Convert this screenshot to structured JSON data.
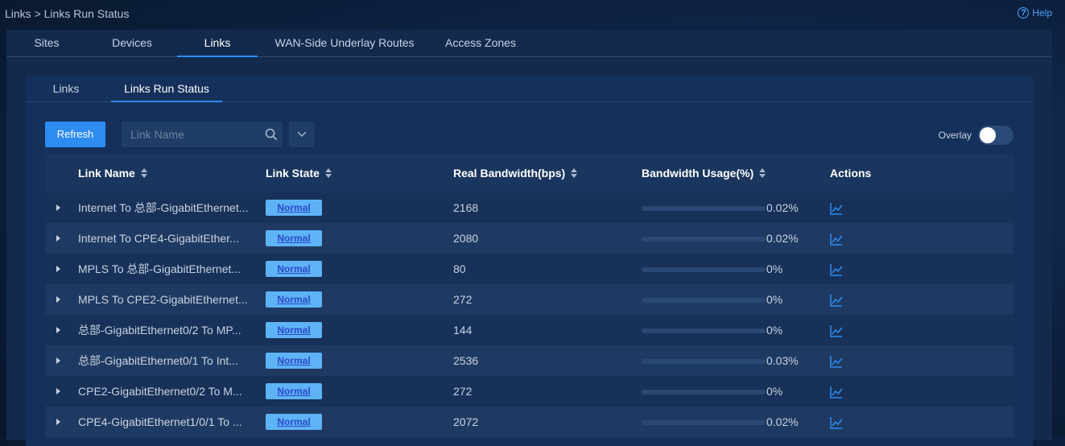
{
  "breadcrumb": "Links > Links Run Status",
  "help_label": "Help",
  "main_tabs": [
    "Sites",
    "Devices",
    "Links",
    "WAN-Side Underlay Routes",
    "Access Zones"
  ],
  "main_tab_active": "Links",
  "sub_tabs": [
    "Links",
    "Links Run Status"
  ],
  "sub_tab_active": "Links Run Status",
  "toolbar": {
    "refresh_label": "Refresh",
    "search_placeholder": "Link Name",
    "overlay_label": "Overlay",
    "overlay_enabled": false
  },
  "table": {
    "columns": [
      "Link Name",
      "Link State",
      "Real Bandwidth(bps)",
      "Bandwidth Usage(%)",
      "Actions"
    ],
    "rows": [
      {
        "name": "Internet To 总部-GigabitEthernet...",
        "state": "Normal",
        "bandwidth": "2168",
        "usage": "0.02%"
      },
      {
        "name": "Internet To CPE4-GigabitEther...",
        "state": "Normal",
        "bandwidth": "2080",
        "usage": "0.02%"
      },
      {
        "name": "MPLS To 总部-GigabitEthernet...",
        "state": "Normal",
        "bandwidth": "80",
        "usage": "0%"
      },
      {
        "name": "MPLS To CPE2-GigabitEthernet...",
        "state": "Normal",
        "bandwidth": "272",
        "usage": "0%"
      },
      {
        "name": "总部-GigabitEthernet0/2 To MP...",
        "state": "Normal",
        "bandwidth": "144",
        "usage": "0%"
      },
      {
        "name": "总部-GigabitEthernet0/1 To Int...",
        "state": "Normal",
        "bandwidth": "2536",
        "usage": "0.03%"
      },
      {
        "name": "CPE2-GigabitEthernet0/2 To M...",
        "state": "Normal",
        "bandwidth": "272",
        "usage": "0%"
      },
      {
        "name": "CPE4-GigabitEthernet1/0/1 To ...",
        "state": "Normal",
        "bandwidth": "2072",
        "usage": "0.02%"
      }
    ]
  },
  "colors": {
    "accent": "#2d8cf0",
    "badge_bg": "#5eb3f6",
    "badge_text": "#2b49c7"
  }
}
